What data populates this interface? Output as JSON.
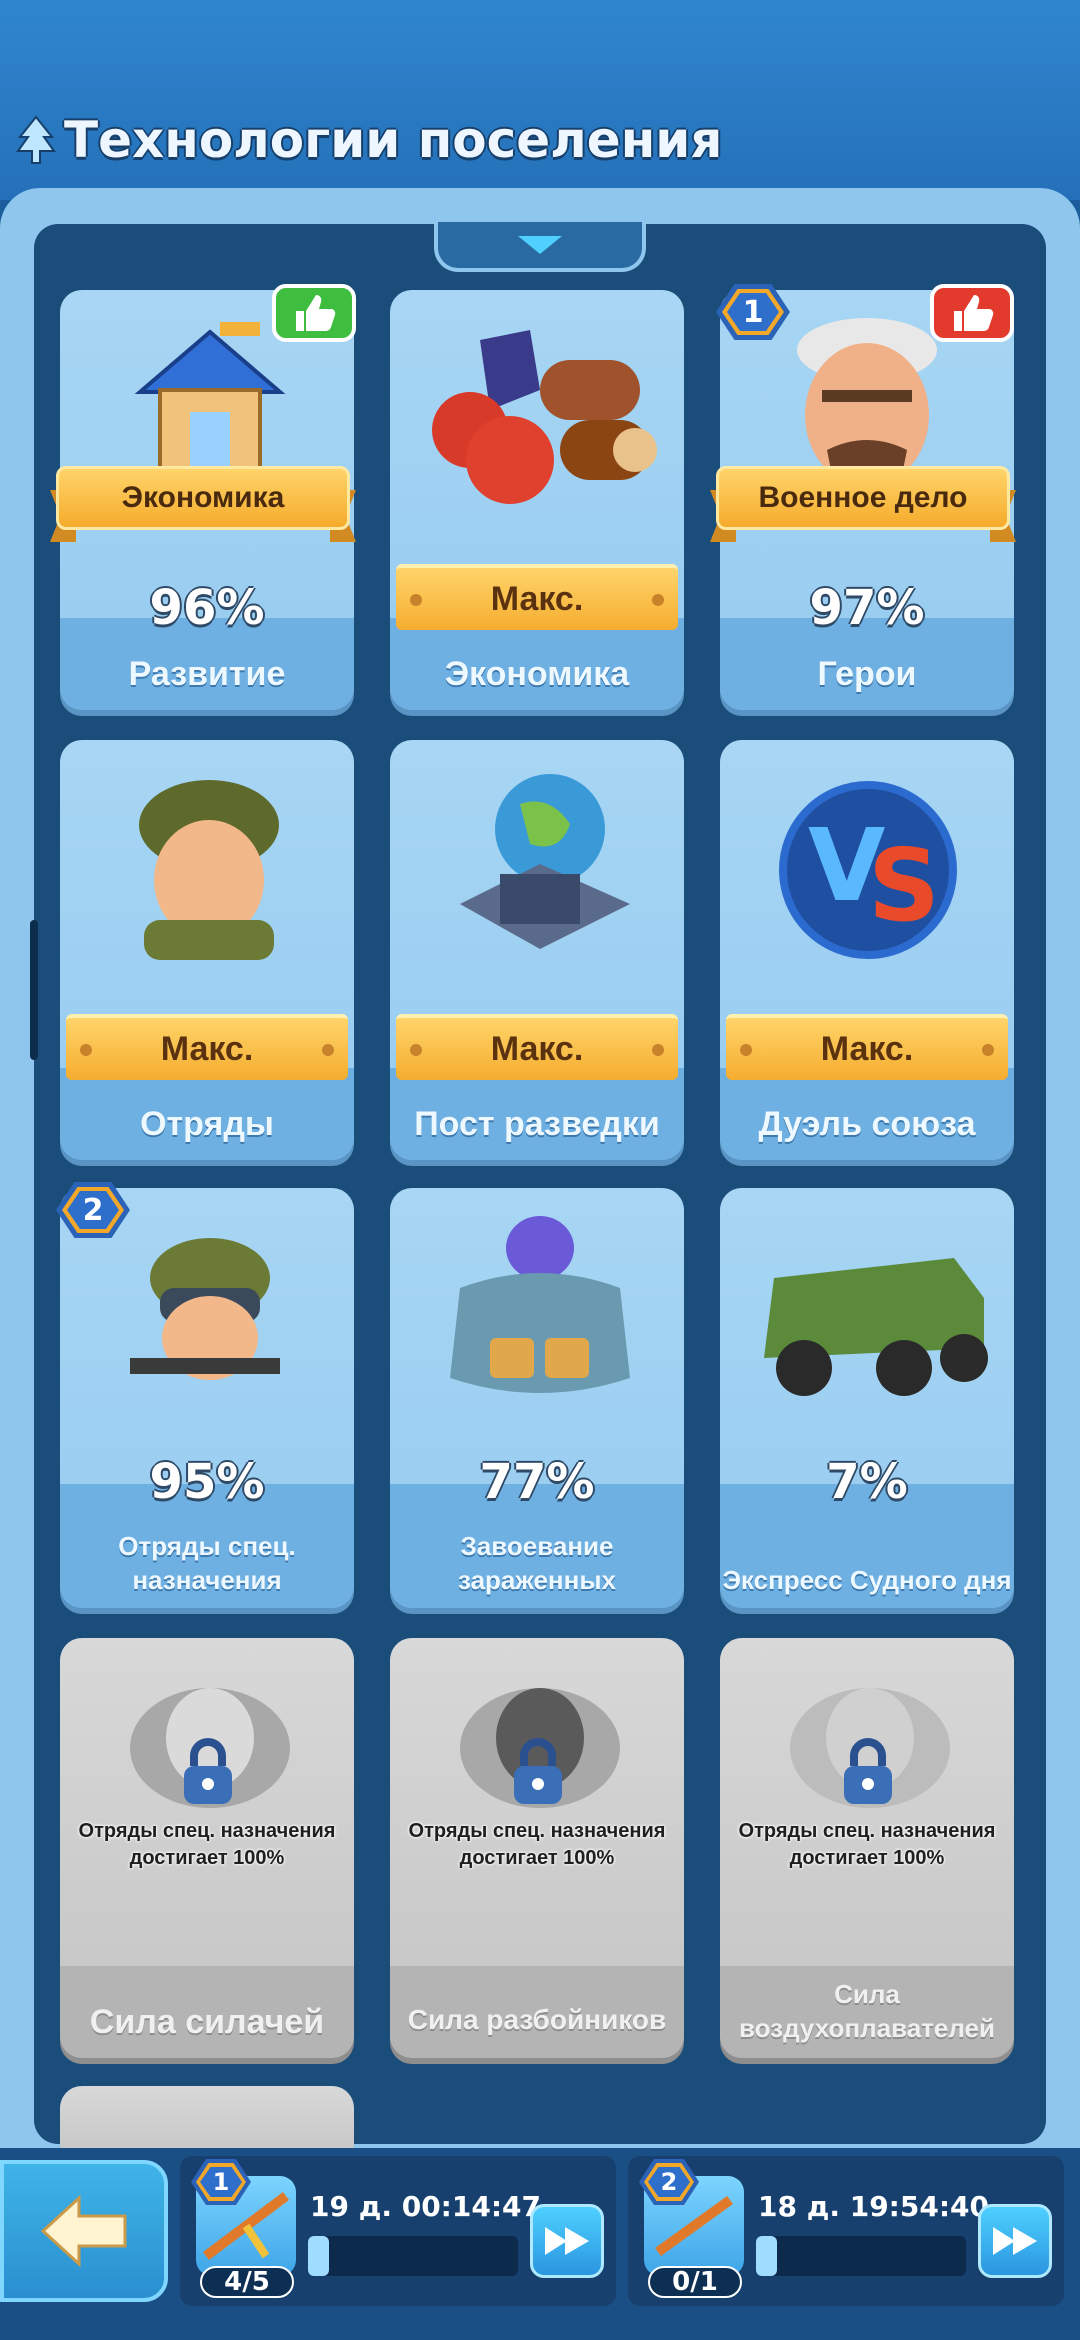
{
  "header": {
    "title": "Технологии поселения"
  },
  "cards": [
    {
      "name": "Развитие",
      "status": "96%",
      "tag": "Экономика"
    },
    {
      "name": "Экономика",
      "status": "Макс."
    },
    {
      "name": "Герои",
      "status": "97%",
      "tag": "Военное дело",
      "badge": "1"
    },
    {
      "name": "Отряды",
      "status": "Макс."
    },
    {
      "name": "Пост разведки",
      "status": "Макс."
    },
    {
      "name": "Дуэль союза",
      "status": "Макс."
    },
    {
      "name": "Отряды спец. назначения",
      "status": "95%",
      "badge": "2"
    },
    {
      "name": "Завоевание зараженных",
      "status": "77%"
    },
    {
      "name": "Экспресс Судного дня",
      "status": "7%"
    },
    {
      "name": "Сила силачей",
      "lock_text": "Отряды спец. назначения достигает 100%"
    },
    {
      "name": "Сила разбойников",
      "lock_text": "Отряды спец. назначения достигает 100%"
    },
    {
      "name": "Сила воздухоплавателей",
      "lock_text": "Отряды спец. назначения достигает 100%"
    }
  ],
  "queues": [
    {
      "badge": "1",
      "time": "19 д. 00:14:47",
      "count": "4/5",
      "progress": 0.1
    },
    {
      "badge": "2",
      "time": "18 д. 19:54:40",
      "count": "0/1",
      "progress": 0.1
    }
  ],
  "colors": {
    "accent": "#f5ad2f",
    "panel": "#1b4d7a",
    "card": "#a8d6f4",
    "locked": "#c4c4c4"
  },
  "icons": [
    "tree-icon",
    "thumbs-up-icon",
    "lock-icon",
    "back-arrow-icon",
    "fast-forward-icon",
    "rifle-icon"
  ]
}
